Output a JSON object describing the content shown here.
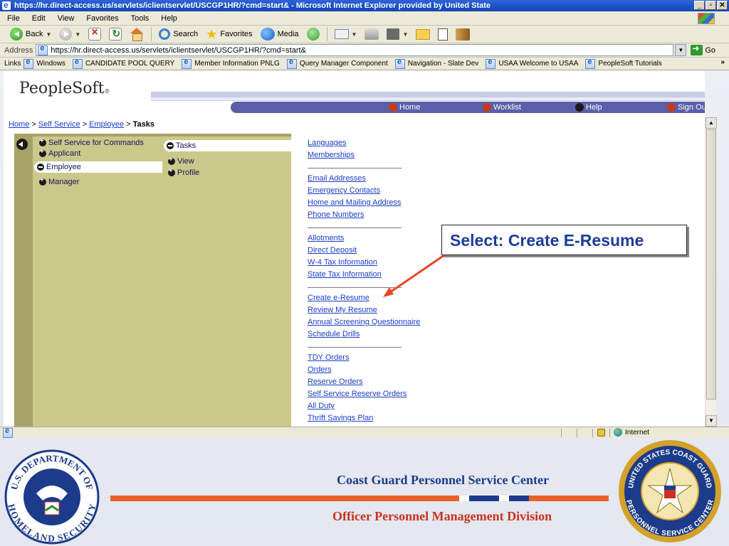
{
  "window": {
    "title": "https://hr.direct-access.us/servlets/iclientservlet/USCGP1HR/?cmd=start& - Microsoft Internet Explorer provided by United State",
    "controls": [
      "_",
      "▫",
      "✕"
    ]
  },
  "menubar": [
    "File",
    "Edit",
    "View",
    "Favorites",
    "Tools",
    "Help"
  ],
  "toolbar": {
    "back": "Back",
    "search": "Search",
    "favorites": "Favorites",
    "media": "Media"
  },
  "address": {
    "label": "Address",
    "url": "https://hr.direct-access.us/servlets/iclientservlet/USCGP1HR/?cmd=start&",
    "go": "Go"
  },
  "links": {
    "label": "Links",
    "items": [
      "Windows",
      "CANDIDATE POOL QUERY",
      "Member Information PNLG",
      "Query Manager Component",
      "Navigation - Slate Dev",
      "USAA  Welcome to USAA",
      "PeopleSoft Tutorials"
    ]
  },
  "peoplesoft": {
    "logo": "PeopleSoft",
    "logo_tm": "®",
    "nav": {
      "home": "Home",
      "worklist": "Worklist",
      "help": "Help",
      "signout": "Sign Out"
    }
  },
  "breadcrumb": {
    "home": "Home",
    "self_service": "Self Service",
    "employee": "Employee",
    "current": "Tasks",
    "sep": ">"
  },
  "menu": {
    "level1": [
      "Self Service for Commands",
      "Applicant",
      "Employee",
      "Manager"
    ],
    "level2": [
      "Tasks",
      "View",
      "Profile"
    ],
    "groups": [
      [
        "Languages",
        "Memberships"
      ],
      [
        "Email Addresses",
        "Emergency Contacts",
        "Home and Mailing Address",
        "Phone Numbers"
      ],
      [
        "Allotments",
        "Direct Deposit",
        "W-4 Tax Information",
        "State Tax Information"
      ],
      [
        "Create e-Resume",
        "Review My Resume",
        "Annual Screening Questionnaire",
        "Schedule Drills"
      ],
      [
        "TDY Orders",
        "Orders",
        "Reserve Orders",
        "Self Service Reserve Orders",
        "All Duty",
        "Thrift Savings Plan"
      ]
    ]
  },
  "status": {
    "zone": "Internet"
  },
  "callout": {
    "text": "Select: Create E-Resume"
  },
  "footer": {
    "title": "Coast Guard Personnel Service Center",
    "subtitle": "Officer Personnel Management Division"
  },
  "seals": {
    "dhs": {
      "top": "U.S. DEPARTMENT OF",
      "bottom": "HOMELAND SECURITY"
    },
    "uscg": {
      "top": "UNITED STATES COAST GUARD",
      "bottom": "PERSONNEL SERVICE CENTER"
    }
  },
  "colors": {
    "ps_nav": "#5a5fa8",
    "menu_olive": "#a8a268",
    "menu_light": "#cbc98a",
    "callout_text": "#1e3c9a",
    "footer_blue": "#1c3b8a",
    "footer_red": "#c8321e",
    "arrow": "#e8462a"
  }
}
